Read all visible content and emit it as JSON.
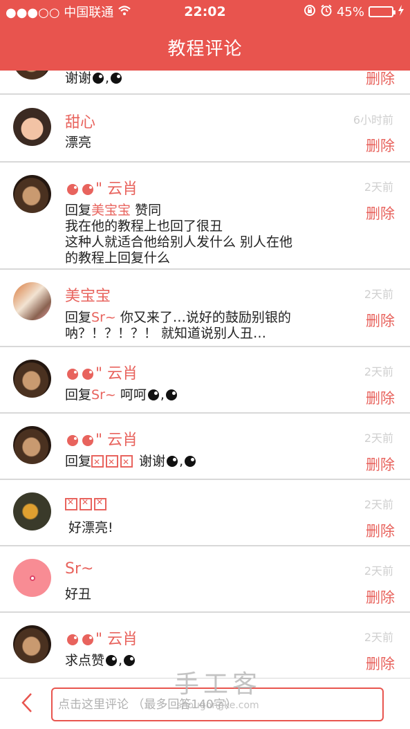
{
  "status_bar": {
    "carrier": "●●●○○ 中国联通",
    "wifi_icon": "wifi-icon",
    "time": "22:02",
    "battery": "45%",
    "battery_level": 0.45
  },
  "header": {
    "title": "教程评论"
  },
  "comments": [
    {
      "user": "",
      "text": "谢谢",
      "time": "",
      "delete": "删除"
    },
    {
      "user": "甜心",
      "text": "漂亮",
      "time": "6小时前",
      "delete": "删除"
    },
    {
      "user": "云肖",
      "reply_prefix": "回复",
      "reply_to": "美宝宝",
      "reply_text": " 赞同",
      "text": "我在他的教程上也回了很丑\n这种人就适合他给别人发什么 别人在他\n的教程上回复什么",
      "time": "2天前",
      "delete": "删除"
    },
    {
      "user": "美宝宝",
      "reply_prefix": "回复",
      "reply_to": "Sr~",
      "reply_text": " 你又来了…说好的鼓励别银的\n呐？！？！？！ 就知道说别人丑…",
      "time": "2天前",
      "delete": "删除"
    },
    {
      "user": "云肖",
      "reply_prefix": "回复",
      "reply_to": "Sr~",
      "reply_text": " 呵呵",
      "time": "2天前",
      "delete": "删除"
    },
    {
      "user": "云肖",
      "reply_prefix": "回复",
      "reply_text": " 谢谢",
      "time": "2天前",
      "delete": "删除"
    },
    {
      "user": "",
      "text": "好漂亮!",
      "time": "2天前",
      "delete": "删除"
    },
    {
      "user": "Sr~",
      "text": "好丑",
      "time": "2天前",
      "delete": "删除"
    },
    {
      "user": "云肖",
      "text": "求点赞",
      "time": "2天前",
      "delete": "删除"
    }
  ],
  "bottom_bar": {
    "back_icon": "chevron-left-icon",
    "input_placeholder": "点击这里评论 （最多回答140字）"
  },
  "watermark": {
    "title": "手工客",
    "url": "shougongke.com"
  },
  "colors": {
    "accent": "#e8544e",
    "name": "#e8635d",
    "time": "#cfcfcf"
  }
}
